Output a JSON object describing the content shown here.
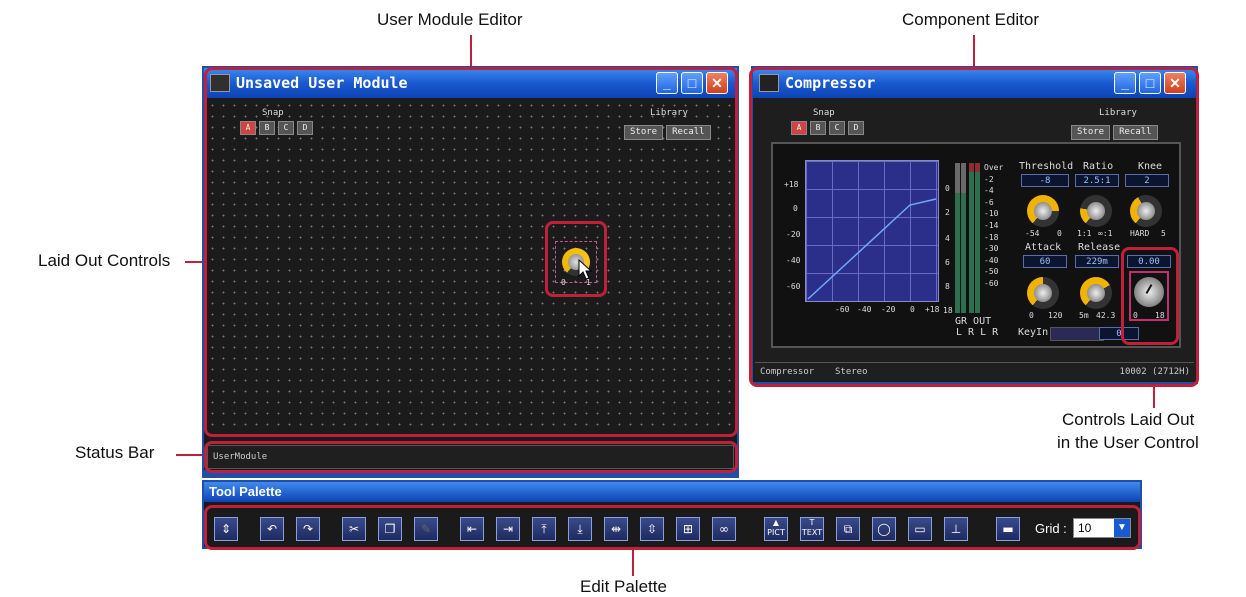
{
  "callouts": {
    "user_module_editor": "User Module Editor",
    "component_editor": "Component Editor",
    "laid_out_controls": "Laid Out Controls",
    "status_bar": "Status Bar",
    "controls_laid_out_line1": "Controls Laid Out",
    "controls_laid_out_line2": "in the User Control",
    "edit_palette": "Edit Palette"
  },
  "user_module_window": {
    "title": "Unsaved User Module",
    "snap_label": "Snap",
    "snap_buttons": [
      "A",
      "B",
      "C",
      "D"
    ],
    "library_label": "Library",
    "store_label": "Store",
    "recall_label": "Recall",
    "knob_ticks": [
      "0",
      "1"
    ],
    "status_text": "UserModule"
  },
  "component_window": {
    "title": "Compressor",
    "snap_label": "Snap",
    "snap_buttons": [
      "A",
      "B",
      "C",
      "D"
    ],
    "library_label": "Library",
    "store_label": "Store",
    "recall_label": "Recall",
    "graph_y_ticks": [
      "+18",
      "0",
      "-20",
      "-40",
      "-60"
    ],
    "graph_x_ticks": [
      "-60",
      "-40",
      "-20",
      "0",
      "+18"
    ],
    "meter_scale": [
      "Over",
      "-2",
      "-4",
      "-6",
      "-10",
      "-14",
      "-18",
      "-30",
      "-40",
      "-50",
      "-60"
    ],
    "gr_scale": [
      "0",
      "2",
      "4",
      "6",
      "8",
      "18"
    ],
    "meter_label_1": "GR OUT",
    "meter_label_2": "L R L R",
    "params": {
      "threshold": {
        "label": "Threshold",
        "value": "-8",
        "min": "-54",
        "max": "0"
      },
      "ratio": {
        "label": "Ratio",
        "value": "2.5:1",
        "min": "1:1",
        "max": "∞:1"
      },
      "knee": {
        "label": "Knee",
        "value": "2",
        "min": "HARD",
        "max": "5"
      },
      "attack": {
        "label": "Attack",
        "value": "60",
        "min": "0",
        "max": "120"
      },
      "release": {
        "label": "Release",
        "value": "229m",
        "min": "5m",
        "max": "42.3"
      },
      "gain": {
        "value": "0.00",
        "min": "0",
        "max": "18"
      }
    },
    "keyin_label": "KeyIn",
    "keyin_value": "0",
    "status_left": "Compressor",
    "status_mid": "Stereo",
    "status_right": "10002 (2712H)"
  },
  "tool_palette": {
    "title": "Tool Palette",
    "grid_label": "Grid :",
    "grid_value": "10",
    "pict_label": "PICT",
    "text_label": "TEXT"
  }
}
